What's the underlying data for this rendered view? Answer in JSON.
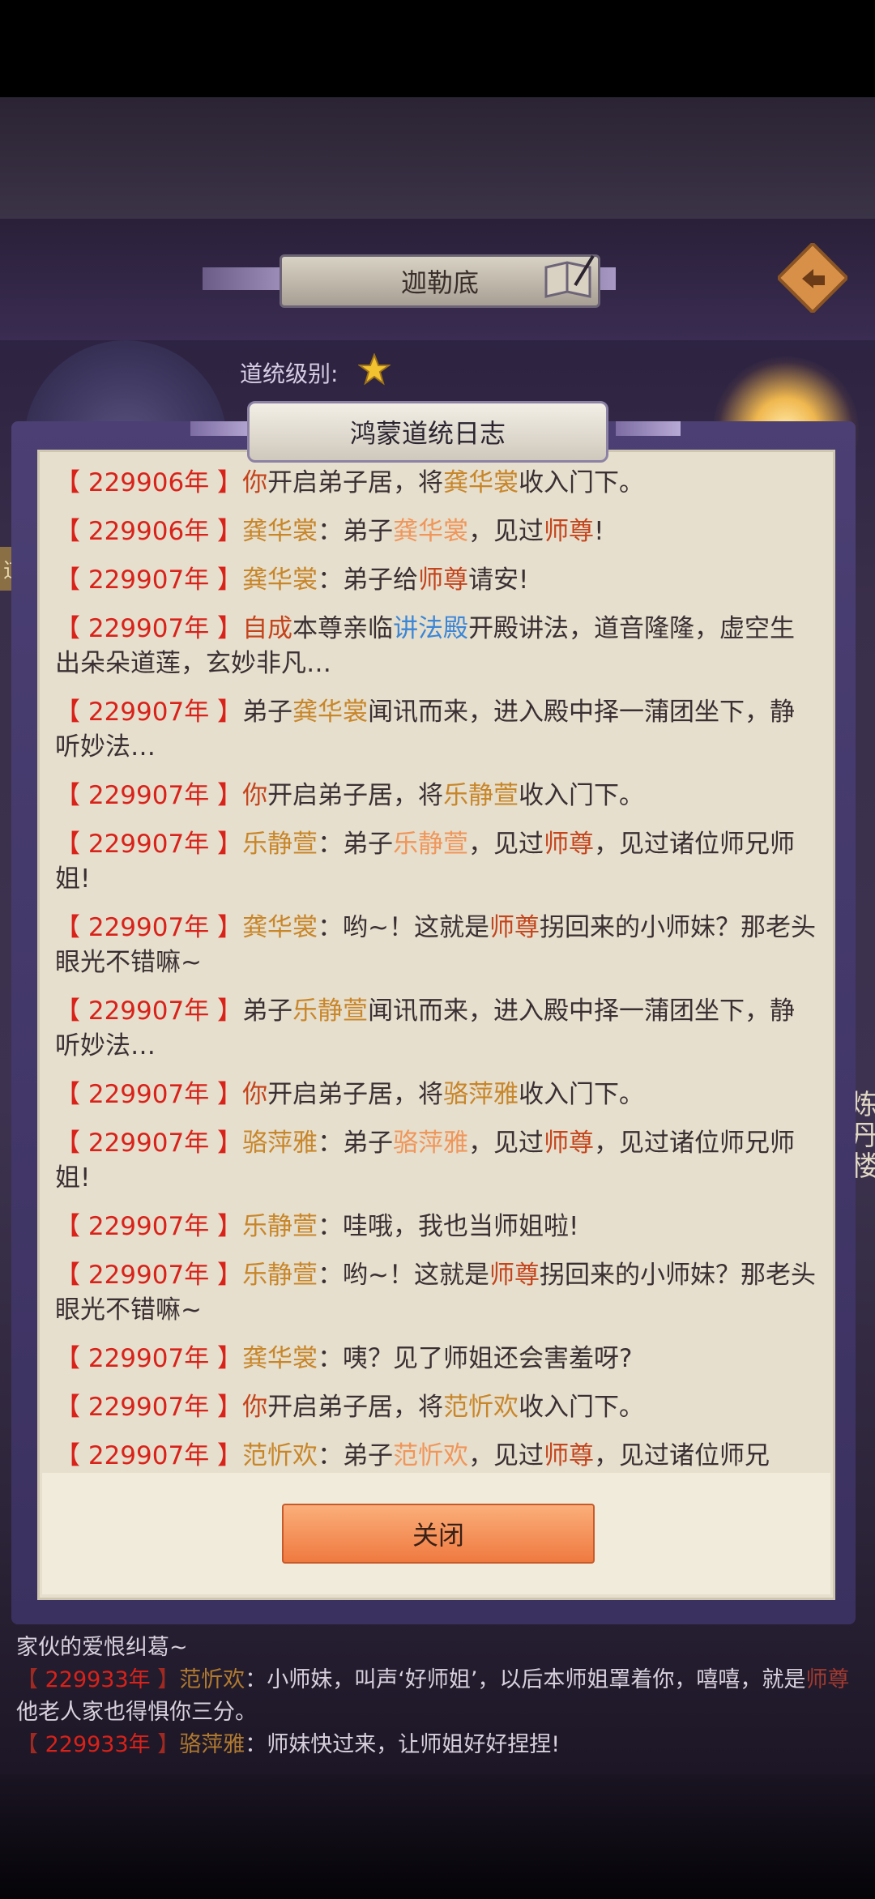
{
  "header": {
    "title": "迦勒底",
    "level_label": "道统级别:"
  },
  "left_tab": "道",
  "right_side_text": "炼丹楼",
  "panel": {
    "title": "鸿蒙道统日志",
    "close_label": "关闭"
  },
  "logs": [
    {
      "year": "229906年",
      "segments": [
        {
          "t": "你",
          "c": "who"
        },
        {
          "t": "开启弟子居，将"
        },
        {
          "t": "龚华裳",
          "c": "nm"
        },
        {
          "t": "收入门下。"
        }
      ]
    },
    {
      "year": "229906年",
      "segments": [
        {
          "t": "龚华裳",
          "c": "nm"
        },
        {
          "t": "：弟子"
        },
        {
          "t": "龚华裳",
          "c": "nm2"
        },
        {
          "t": "，见过"
        },
        {
          "t": "师尊",
          "c": "sz"
        },
        {
          "t": "!"
        }
      ]
    },
    {
      "year": "229907年",
      "segments": [
        {
          "t": "龚华裳",
          "c": "nm"
        },
        {
          "t": "：弟子给"
        },
        {
          "t": "师尊",
          "c": "sz"
        },
        {
          "t": "请安!"
        }
      ]
    },
    {
      "year": "229907年",
      "segments": [
        {
          "t": "自成",
          "c": "who"
        },
        {
          "t": "本尊亲临"
        },
        {
          "t": "讲法殿",
          "c": "loc"
        },
        {
          "t": "开殿讲法，道音隆隆，虚空生出朵朵道莲，玄妙非凡…"
        }
      ]
    },
    {
      "year": "229907年",
      "segments": [
        {
          "t": "弟子"
        },
        {
          "t": "龚华裳",
          "c": "nm"
        },
        {
          "t": "闻讯而来，进入殿中择一蒲团坐下，静听妙法…"
        }
      ]
    },
    {
      "year": "229907年",
      "segments": [
        {
          "t": "你",
          "c": "who"
        },
        {
          "t": "开启弟子居，将"
        },
        {
          "t": "乐静萱",
          "c": "nm"
        },
        {
          "t": "收入门下。"
        }
      ]
    },
    {
      "year": "229907年",
      "segments": [
        {
          "t": "乐静萱",
          "c": "nm"
        },
        {
          "t": "：弟子"
        },
        {
          "t": "乐静萱",
          "c": "nm2"
        },
        {
          "t": "，见过"
        },
        {
          "t": "师尊",
          "c": "sz"
        },
        {
          "t": "，见过诸位师兄师姐!"
        }
      ]
    },
    {
      "year": "229907年",
      "segments": [
        {
          "t": "龚华裳",
          "c": "nm"
        },
        {
          "t": "：哟~！这就是"
        },
        {
          "t": "师尊",
          "c": "sz"
        },
        {
          "t": "拐回来的小师妹？那老头眼光不错嘛~"
        }
      ]
    },
    {
      "year": "229907年",
      "segments": [
        {
          "t": "弟子"
        },
        {
          "t": "乐静萱",
          "c": "nm"
        },
        {
          "t": "闻讯而来，进入殿中择一蒲团坐下，静听妙法…"
        }
      ]
    },
    {
      "year": "229907年",
      "segments": [
        {
          "t": "你",
          "c": "who"
        },
        {
          "t": "开启弟子居，将"
        },
        {
          "t": "骆萍雅",
          "c": "nm"
        },
        {
          "t": "收入门下。"
        }
      ]
    },
    {
      "year": "229907年",
      "segments": [
        {
          "t": "骆萍雅",
          "c": "nm"
        },
        {
          "t": "：弟子"
        },
        {
          "t": "骆萍雅",
          "c": "nm2"
        },
        {
          "t": "，见过"
        },
        {
          "t": "师尊",
          "c": "sz"
        },
        {
          "t": "，见过诸位师兄师姐!"
        }
      ]
    },
    {
      "year": "229907年",
      "segments": [
        {
          "t": "乐静萱",
          "c": "nm"
        },
        {
          "t": "：哇哦，我也当师姐啦!"
        }
      ]
    },
    {
      "year": "229907年",
      "segments": [
        {
          "t": "乐静萱",
          "c": "nm"
        },
        {
          "t": "：哟~！这就是"
        },
        {
          "t": "师尊",
          "c": "sz"
        },
        {
          "t": "拐回来的小师妹？那老头眼光不错嘛~"
        }
      ]
    },
    {
      "year": "229907年",
      "segments": [
        {
          "t": "龚华裳",
          "c": "nm"
        },
        {
          "t": "：咦？见了师姐还会害羞呀?"
        }
      ]
    },
    {
      "year": "229907年",
      "segments": [
        {
          "t": "你",
          "c": "who"
        },
        {
          "t": "开启弟子居，将"
        },
        {
          "t": "范忻欢",
          "c": "nm"
        },
        {
          "t": "收入门下。"
        }
      ]
    },
    {
      "year": "229907年",
      "segments": [
        {
          "t": "范忻欢",
          "c": "nm"
        },
        {
          "t": "：弟子"
        },
        {
          "t": "范忻欢",
          "c": "nm2"
        },
        {
          "t": "，见过"
        },
        {
          "t": "师尊",
          "c": "sz"
        },
        {
          "t": "，见过诸位师兄"
        }
      ]
    }
  ],
  "background_chat": [
    {
      "segments": [
        {
          "t": "家伙的爱恨纠葛~"
        }
      ]
    },
    {
      "year": "229933年",
      "segments": [
        {
          "t": "范忻欢",
          "c": "nm"
        },
        {
          "t": "：小师妹，叫声‘好师姐’，以后本师姐罩着你，嘻嘻，就是"
        },
        {
          "t": "师尊",
          "c": "sz"
        },
        {
          "t": "他老人家也得惧你三分。"
        }
      ]
    },
    {
      "year": "229933年",
      "segments": [
        {
          "t": "骆萍雅",
          "c": "nm"
        },
        {
          "t": "：师妹快过来，让师姐好好捏捏!"
        }
      ]
    }
  ]
}
